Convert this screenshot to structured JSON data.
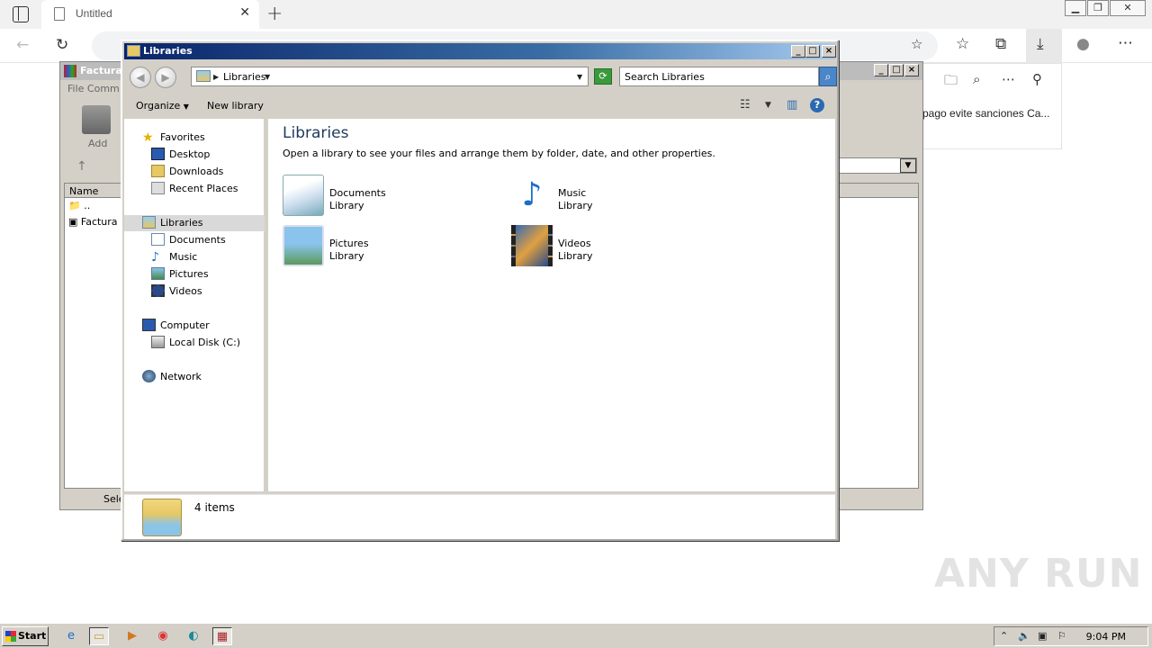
{
  "browser": {
    "tab_title": "Untitled",
    "side_panel_text": "pago evite sanciones Ca..."
  },
  "winrar": {
    "title": "Factura",
    "menu": "File   Comm",
    "add_label": "Add",
    "col_name": "Name",
    "rows": [
      "..",
      "Factura"
    ],
    "status": "Sele"
  },
  "explorer": {
    "title": "Libraries",
    "address": "Libraries",
    "search_placeholder": "Search Libraries",
    "organize": "Organize",
    "new_library": "New library",
    "nav": {
      "favorites": "Favorites",
      "desktop": "Desktop",
      "downloads": "Downloads",
      "recent": "Recent Places",
      "libraries": "Libraries",
      "documents": "Documents",
      "music": "Music",
      "pictures": "Pictures",
      "videos": "Videos",
      "computer": "Computer",
      "local_disk": "Local Disk (C:)",
      "network": "Network"
    },
    "heading": "Libraries",
    "subtitle": "Open a library to see your files and arrange them by folder, date, and other properties.",
    "libraries": [
      {
        "name": "Documents",
        "kind": "Library"
      },
      {
        "name": "Music",
        "kind": "Library"
      },
      {
        "name": "Pictures",
        "kind": "Library"
      },
      {
        "name": "Videos",
        "kind": "Library"
      }
    ],
    "item_count": "4 items"
  },
  "taskbar": {
    "start": "Start",
    "clock": "9:04 PM"
  },
  "watermark": "ANY RUN"
}
